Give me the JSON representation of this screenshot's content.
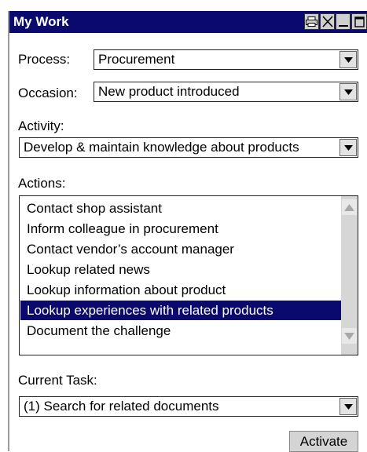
{
  "window": {
    "title": "My Work"
  },
  "fields": {
    "process_label": "Process:",
    "process_value": "Procurement",
    "occasion_label": "Occasion:",
    "occasion_value": "New product introduced",
    "activity_label": "Activity:",
    "activity_value": "Develop & maintain knowledge about products",
    "actions_label": "Actions:",
    "current_task_label": "Current Task:",
    "current_task_value": "(1) Search for related documents"
  },
  "actions": [
    "Contact shop assistant",
    "Inform colleague in procurement",
    "Contact vendor’s account manager",
    "Lookup related news",
    "Lookup information about product",
    "Lookup experiences with related products",
    "Document the challenge"
  ],
  "selected_action": 5,
  "buttons": {
    "activate": "Activate"
  },
  "icons": [
    "print-icon",
    "close-icon",
    "minimize-icon",
    "maximize-icon",
    "dropdown-arrow-icon",
    "scroll-up-icon",
    "scroll-down-icon"
  ]
}
